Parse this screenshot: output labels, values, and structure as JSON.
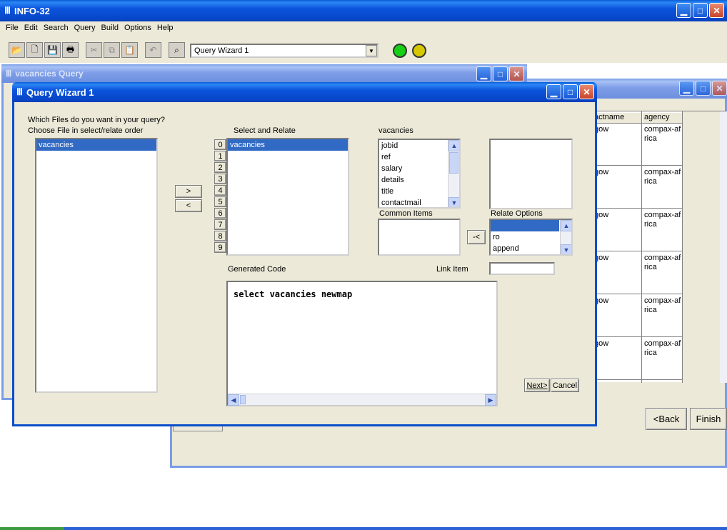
{
  "app": {
    "title": "INFO-32",
    "menu": [
      "File",
      "Edit",
      "Search",
      "Query",
      "Build",
      "Options",
      "Help"
    ],
    "toolbar_combo_value": "Query Wizard 1",
    "status_lights": {
      "green": "#16d016",
      "yellow": "#d6c800"
    }
  },
  "query_window": {
    "title": "vacancies Query"
  },
  "back_window": {
    "columns": [
      "actname",
      "agency"
    ],
    "rows": [
      {
        "c1": "gow",
        "c2": "compax-af rica"
      },
      {
        "c1": "gow",
        "c2": "compax-af rica"
      },
      {
        "c1": "gow",
        "c2": "compax-af rica"
      },
      {
        "c1": "gow",
        "c2": "compax-af rica"
      },
      {
        "c1": "gow",
        "c2": "compax-af rica"
      },
      {
        "c1": "gow",
        "c2": "compax-af rica"
      }
    ],
    "back_button": "<Back",
    "finish_button": "Finish"
  },
  "wizard": {
    "title": "Query Wizard 1",
    "prompt_line1": "Which Files do you want in your query?",
    "prompt_line2": "Choose File in select/relate order",
    "files": [
      "vacancies"
    ],
    "add_button": ">",
    "remove_button": "<",
    "select_relate_label": "Select and Relate",
    "slot_numbers": [
      "0",
      "1",
      "2",
      "3",
      "4",
      "5",
      "6",
      "7",
      "8",
      "9"
    ],
    "select_relate_items": [
      "vacancies"
    ],
    "fields_label": "vacancies",
    "fields": [
      "jobid",
      "ref",
      "salary",
      "details",
      "title",
      "contactmail"
    ],
    "common_items_label": "Common Items",
    "link_button": "-<",
    "relate_options_label": "Relate Options",
    "relate_options": [
      "",
      "ro",
      "append"
    ],
    "generated_code_label": "Generated Code",
    "link_item_label": "Link Item",
    "link_item_value": "",
    "generated_code": "select vacancies newmap",
    "next_button": "Next>",
    "cancel_button": "Cancel"
  }
}
